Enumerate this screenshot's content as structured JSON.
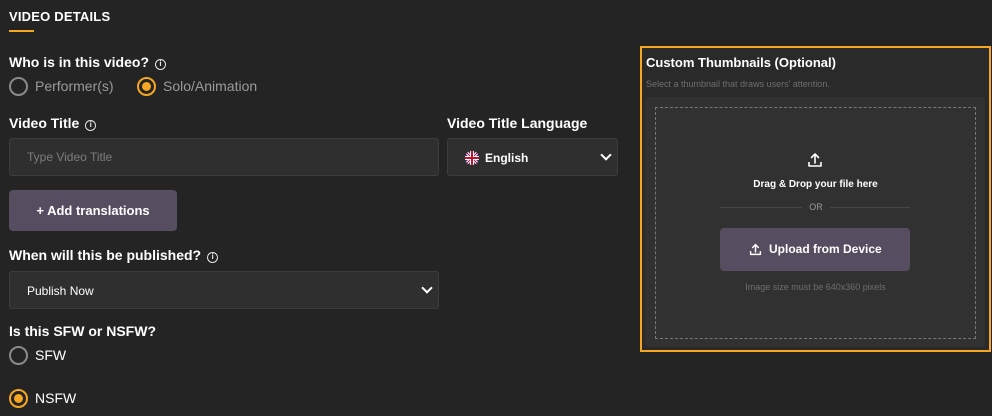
{
  "section": {
    "title": "VIDEO DETAILS"
  },
  "performer_question": {
    "label": "Who is in this video?",
    "info_icon": "info-circle-icon",
    "options": [
      {
        "label": "Performer(s)",
        "selected": false
      },
      {
        "label": "Solo/Animation",
        "selected": true
      }
    ]
  },
  "video_title": {
    "label": "Video Title",
    "info_icon": "info-circle-icon",
    "value": "",
    "placeholder": "Type Video Title"
  },
  "title_language": {
    "label": "Video Title Language",
    "selected": "English",
    "flag_icon": "uk-flag-icon"
  },
  "translations": {
    "button_label": "+ Add translations"
  },
  "publish": {
    "label": "When will this be published?",
    "info_icon": "info-circle-icon",
    "selected": "Publish Now"
  },
  "rating": {
    "label": "Is this SFW or NSFW?",
    "options": [
      {
        "label": "SFW",
        "selected": false
      },
      {
        "label": "NSFW",
        "selected": true
      }
    ]
  },
  "thumbnails": {
    "title": "Custom Thumbnails (Optional)",
    "subtitle": "Select a thumbnail that draws users' attention.",
    "upload_icon": "upload-icon",
    "drag_text": "Drag & Drop your file here",
    "or_text": "OR",
    "upload_button": "Upload from Device",
    "size_hint": "Image size must be 640x360 pixels"
  },
  "colors": {
    "background": "#242424",
    "accent": "#f5a623",
    "button": "#564d60",
    "field": "#2f2f2f"
  }
}
